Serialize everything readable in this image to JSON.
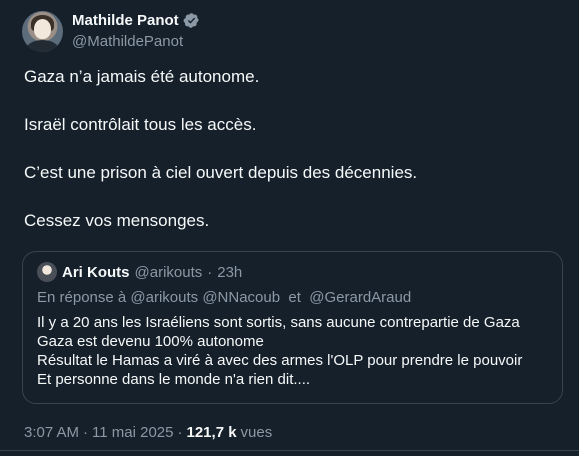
{
  "author": {
    "display_name": "Mathilde Panot",
    "handle": "@MathildePanot",
    "verified_icon": "verified-badge-icon",
    "verified_color": "#8b98a5"
  },
  "tweet": {
    "lines": [
      "Gaza n’a jamais été autonome.",
      "Israël contrôlait tous les accès.",
      "C’est une prison à ciel ouvert depuis des décennies.",
      "Cessez vos mensonges."
    ]
  },
  "quote": {
    "display_name": "Ari Kouts",
    "handle": "@arikouts",
    "separator": "·",
    "age": "23h",
    "reply_context": "En réponse à @arikouts @NNacoub  et  @GerardAraud",
    "lines": [
      "Il y a 20 ans les Israéliens sont sortis, sans aucune contrepartie de Gaza",
      "Gaza est devenu 100% autonome",
      "Résultat le Hamas a viré à avec des armes l'OLP pour prendre le pouvoir",
      "Et personne dans le monde n'a rien dit...."
    ]
  },
  "footer": {
    "time": "3:07 AM",
    "separator1": "·",
    "date": "11 mai 2025",
    "separator2": "·",
    "views_count": "121,7 k",
    "views_label": "vues"
  },
  "colors": {
    "background": "#15202b",
    "text_primary": "#f7f9f9",
    "text_secondary": "#8b98a5",
    "border": "#38444d"
  }
}
